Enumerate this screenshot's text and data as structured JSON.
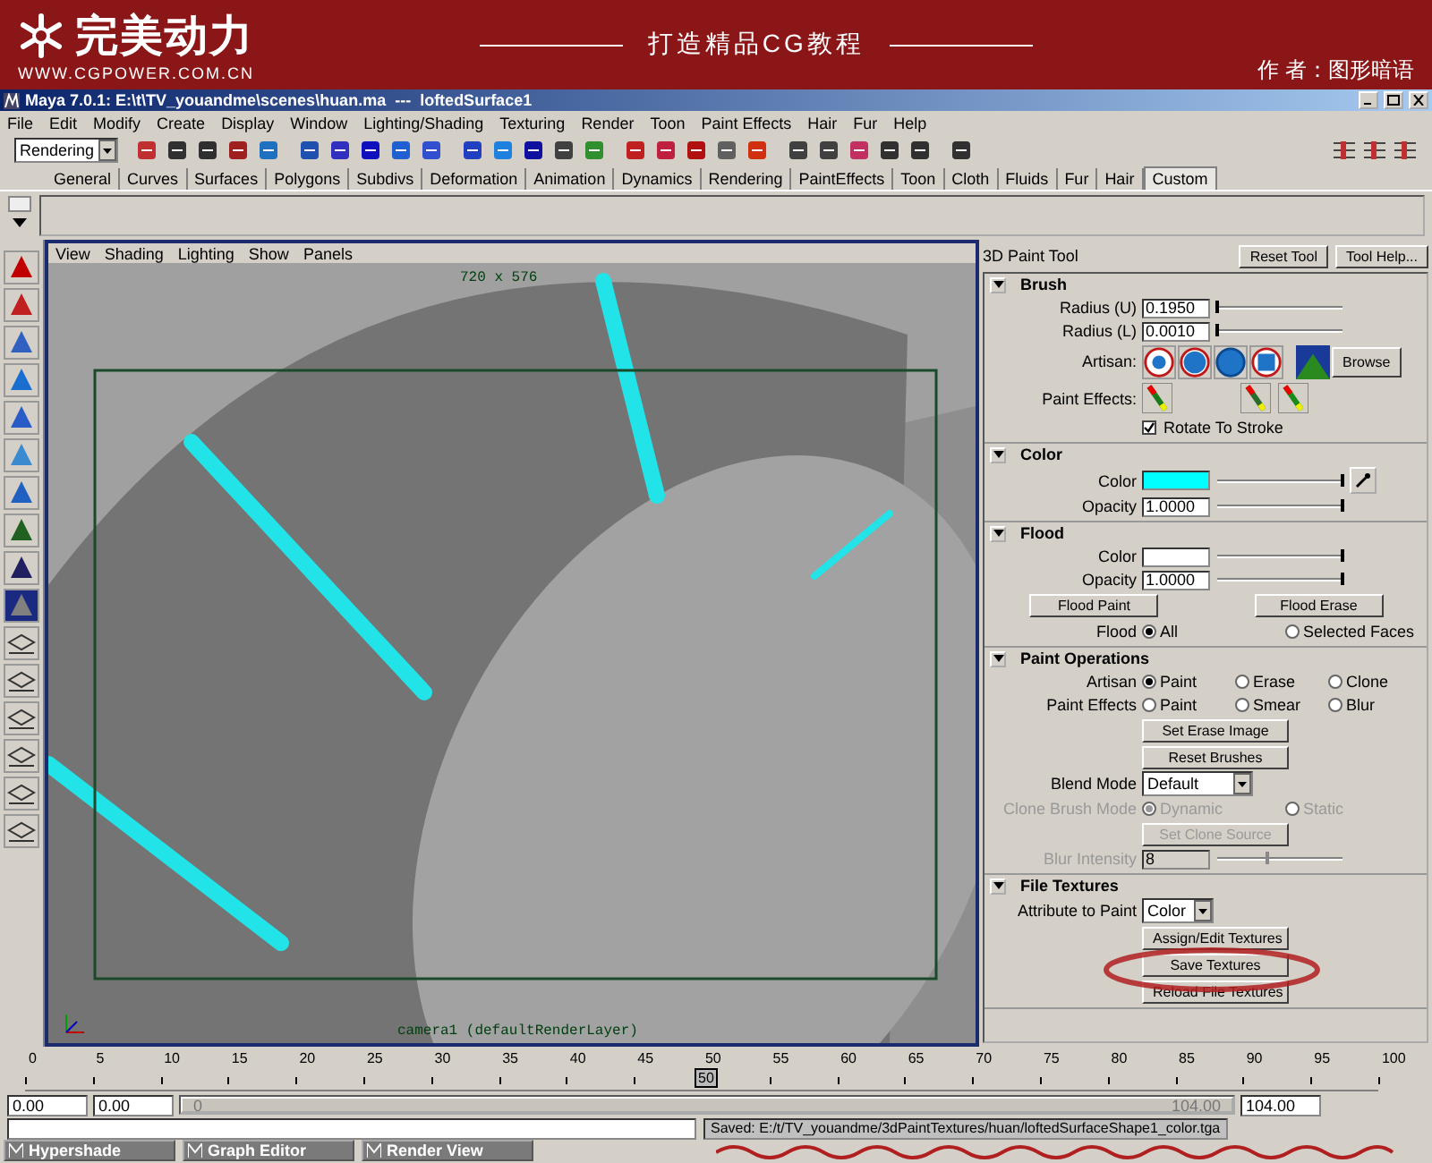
{
  "banner": {
    "logo": "完美动力",
    "url": "WWW.CGPOWER.COM.CN",
    "slogan": "打造精品CG教程",
    "author": "作 者：图形暗语"
  },
  "window": {
    "title": "Maya 7.0.1: E:\\t\\TV_youandme\\scenes\\huan.ma  ---  loftedSurface1"
  },
  "menu": [
    "File",
    "Edit",
    "Modify",
    "Create",
    "Display",
    "Window",
    "Lighting/Shading",
    "Texturing",
    "Render",
    "Toon",
    "Paint Effects",
    "Hair",
    "Fur",
    "Help"
  ],
  "toolbar": {
    "menu_set": "Rendering"
  },
  "shelf": {
    "tabs": [
      {
        "label": "General",
        "selected": false
      },
      {
        "label": "Curves",
        "selected": false
      },
      {
        "label": "Surfaces",
        "selected": false
      },
      {
        "label": "Polygons",
        "selected": false
      },
      {
        "label": "Subdivs",
        "selected": false
      },
      {
        "label": "Deformation",
        "selected": false
      },
      {
        "label": "Animation",
        "selected": false
      },
      {
        "label": "Dynamics",
        "selected": false
      },
      {
        "label": "Rendering",
        "selected": false
      },
      {
        "label": "PaintEffects",
        "selected": false
      },
      {
        "label": "Toon",
        "selected": false
      },
      {
        "label": "Cloth",
        "selected": false
      },
      {
        "label": "Fluids",
        "selected": false
      },
      {
        "label": "Fur",
        "selected": false
      },
      {
        "label": "Hair",
        "selected": false
      },
      {
        "label": "Custom",
        "selected": true
      }
    ]
  },
  "viewport": {
    "menu": [
      "View",
      "Shading",
      "Lighting",
      "Show",
      "Panels"
    ],
    "resolution": "720 x 576",
    "camera": "camera1 (defaultRenderLayer)"
  },
  "tool_settings": {
    "title": "3D Paint Tool",
    "buttons": [
      "Reset Tool",
      "Tool Help..."
    ],
    "sections": [
      {
        "title": "Brush",
        "expanded": true,
        "rows": [
          {
            "kind": "field_slider",
            "label": "Radius (U)",
            "value": "0.1950",
            "level": 0.0
          },
          {
            "kind": "field_slider",
            "label": "Radius (L)",
            "value": "0.0010",
            "level": 0.0
          },
          {
            "kind": "artisan",
            "label": "Artisan:",
            "button": "Browse"
          },
          {
            "kind": "effects",
            "label": "Paint Effects:"
          },
          {
            "kind": "checkbox",
            "label": "Rotate To Stroke",
            "checked": true
          }
        ]
      },
      {
        "title": "Color",
        "expanded": true,
        "rows": [
          {
            "kind": "color_slider",
            "label": "Color",
            "color": "#00ffff",
            "level": 1.0,
            "picker": true
          },
          {
            "kind": "field_slider",
            "label": "Opacity",
            "value": "1.0000",
            "level": 1.0
          }
        ]
      },
      {
        "title": "Flood",
        "expanded": true,
        "rows": [
          {
            "kind": "color_slider",
            "label": "Color",
            "color": "#ffffff",
            "level": 1.0,
            "picker": false
          },
          {
            "kind": "field_slider",
            "label": "Opacity",
            "value": "1.0000",
            "level": 1.0
          },
          {
            "kind": "button_pair",
            "buttons": [
              "Flood Paint",
              "Flood Erase"
            ]
          },
          {
            "kind": "radio",
            "label": "Flood",
            "disabled": false,
            "options": [
              {
                "label": "All",
                "selected": true
              },
              {
                "label": "Selected Faces",
                "selected": false
              }
            ]
          }
        ]
      },
      {
        "title": "Paint Operations",
        "expanded": true,
        "rows": [
          {
            "kind": "radio",
            "label": "Artisan",
            "disabled": false,
            "options": [
              {
                "label": "Paint",
                "selected": true
              },
              {
                "label": "Erase",
                "selected": false
              },
              {
                "label": "Clone",
                "selected": false
              }
            ]
          },
          {
            "kind": "radio",
            "label": "Paint Effects",
            "disabled": false,
            "options": [
              {
                "label": "Paint",
                "selected": false
              },
              {
                "label": "Smear",
                "selected": false
              },
              {
                "label": "Blur",
                "selected": false
              }
            ]
          },
          {
            "kind": "button",
            "label": "Set Erase Image",
            "disabled": false
          },
          {
            "kind": "button",
            "label": "Reset Brushes",
            "disabled": false
          },
          {
            "kind": "dropdown",
            "label": "Blend Mode",
            "value": "Default"
          },
          {
            "kind": "radio",
            "label": "Clone Brush Mode",
            "disabled": true,
            "options": [
              {
                "label": "Dynamic",
                "selected": true
              },
              {
                "label": "Static",
                "selected": false
              }
            ]
          },
          {
            "kind": "button",
            "label": "Set Clone Source",
            "disabled": true
          },
          {
            "kind": "field_slider",
            "label": "Blur Intensity",
            "value": "8",
            "level": 0.4,
            "disabled": true
          }
        ]
      },
      {
        "title": "File Textures",
        "expanded": true,
        "rows": [
          {
            "kind": "dropdown",
            "label": "Attribute to Paint",
            "value": "Color"
          },
          {
            "kind": "button",
            "label": "Assign/Edit Textures",
            "disabled": false
          },
          {
            "kind": "button",
            "label": "Save Textures",
            "disabled": false
          },
          {
            "kind": "button",
            "label": "Reload File Textures",
            "disabled": false
          }
        ]
      }
    ]
  },
  "timeline": {
    "ticks": [
      "0",
      "5",
      "10",
      "15",
      "20",
      "25",
      "30",
      "35",
      "40",
      "45",
      "50",
      "55",
      "60",
      "65",
      "70",
      "75",
      "80",
      "85",
      "90",
      "95",
      "100"
    ],
    "current": "50",
    "level": 0.5
  },
  "range": {
    "start": "0.00",
    "playback_start": "0.00",
    "slider_start": "0",
    "slider_end": "104.00",
    "end": "104.00",
    "level": 1.0
  },
  "status": {
    "message": "Saved: E:/t/TV_youandme/3dPaintTextures/huan/loftedSurfaceShape1_color.tga"
  },
  "taskbar": [
    {
      "label": "Hypershade"
    },
    {
      "label": "Graph Editor"
    },
    {
      "label": "Render View"
    }
  ]
}
